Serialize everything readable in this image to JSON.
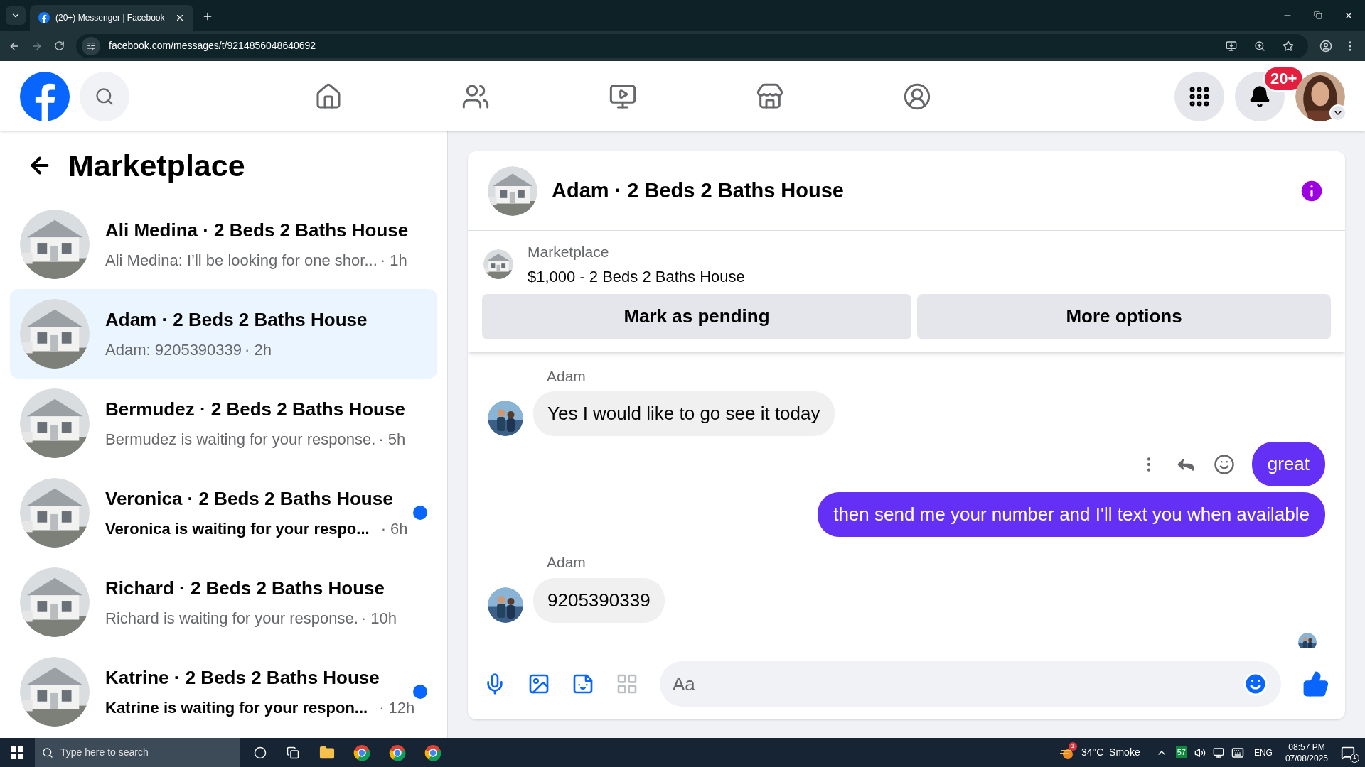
{
  "browser": {
    "tab_title": "(20+) Messenger | Facebook",
    "url": "facebook.com/messages/t/9214856048640692"
  },
  "header": {
    "nav": [
      {
        "kind": "home",
        "selected": false
      },
      {
        "kind": "friends",
        "selected": false
      },
      {
        "kind": "video",
        "selected": false
      },
      {
        "kind": "marketplace",
        "selected": false
      },
      {
        "kind": "groups",
        "selected": false
      }
    ],
    "notification_badge": "20+"
  },
  "sidebar": {
    "title": "Marketplace",
    "conversations": [
      {
        "name": "Ali Medina · 2 Beds 2 Baths House",
        "preview": "Ali Medina: I’ll be looking for one shor...",
        "time": "· 1h",
        "selected": false,
        "unread": false
      },
      {
        "name": "Adam · 2 Beds 2 Baths House",
        "preview": "Adam: 9205390339",
        "time": "· 2h",
        "selected": true,
        "unread": false
      },
      {
        "name": "Bermudez · 2 Beds 2 Baths House",
        "preview": "Bermudez is waiting for your response.",
        "time": "· 5h",
        "selected": false,
        "unread": false
      },
      {
        "name": "Veronica · 2 Beds 2 Baths House",
        "preview": "Veronica is waiting for your respo...",
        "time": "· 6h",
        "selected": false,
        "unread": true
      },
      {
        "name": "Richard · 2 Beds 2 Baths House",
        "preview": "Richard is waiting for your response.",
        "time": "· 10h",
        "selected": false,
        "unread": false
      },
      {
        "name": "Katrine · 2 Beds 2 Baths House",
        "preview": "Katrine is waiting for your respon...",
        "time": "· 12h",
        "selected": false,
        "unread": true
      }
    ]
  },
  "chat": {
    "title": "Adam · 2 Beds 2 Baths House",
    "listing": {
      "label": "Marketplace",
      "title": "$1,000 - 2 Beds 2 Baths House",
      "buttons": [
        "Mark as pending",
        "More options"
      ]
    },
    "messages": [
      {
        "kind": "incoming",
        "sender": "Adam",
        "text": "Yes I would like to go see it today"
      },
      {
        "kind": "outgoing",
        "text": "great",
        "show_actions": true
      },
      {
        "kind": "outgoing",
        "text": "then send me your number and I'll text you when available",
        "show_actions": false
      },
      {
        "kind": "incoming",
        "sender": "Adam",
        "text": "9205390339"
      }
    ],
    "composer": {
      "placeholder": "Aa"
    }
  },
  "taskbar": {
    "search_placeholder": "Type here to search",
    "weather": "34°C  Smoke",
    "weather_badge": "1",
    "tray_green": "57",
    "language": "ENG",
    "time": "08:57 PM",
    "date": "07/08/2025",
    "notification_count": "1"
  }
}
